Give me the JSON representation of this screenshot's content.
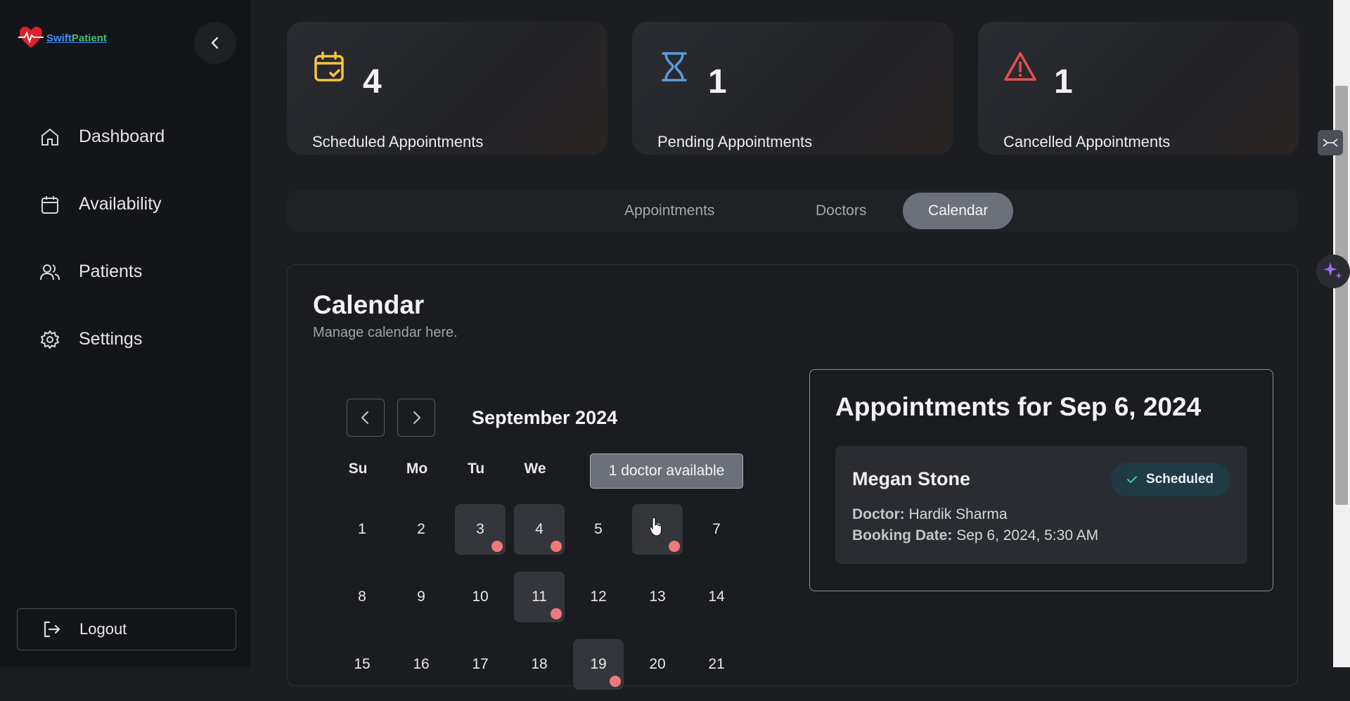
{
  "app": {
    "name_part1": "Swift",
    "name_part2": "Patient"
  },
  "sidebar": {
    "items": [
      {
        "label": "Dashboard",
        "icon": "home-icon"
      },
      {
        "label": "Availability",
        "icon": "calendar-icon"
      },
      {
        "label": "Patients",
        "icon": "users-icon"
      },
      {
        "label": "Settings",
        "icon": "gear-icon"
      }
    ],
    "logout_label": "Logout"
  },
  "stats": [
    {
      "value": "4",
      "label": "Scheduled Appointments",
      "icon": "calendar-check-icon",
      "color": "#f5c542"
    },
    {
      "value": "1",
      "label": "Pending Appointments",
      "icon": "hourglass-icon",
      "color": "#5b9be0"
    },
    {
      "value": "1",
      "label": "Cancelled Appointments",
      "icon": "warning-icon",
      "color": "#e85050"
    }
  ],
  "tabs": [
    {
      "label": "Appointments",
      "active": false
    },
    {
      "label": "Doctors",
      "active": false
    },
    {
      "label": "Calendar",
      "active": true
    }
  ],
  "calendar": {
    "title": "Calendar",
    "subtitle": "Manage calendar here.",
    "month_label": "September 2024",
    "weekdays": [
      "Su",
      "Mo",
      "Tu",
      "We"
    ],
    "tooltip": "1 doctor available",
    "days": [
      {
        "n": "1",
        "has": false
      },
      {
        "n": "2",
        "has": false
      },
      {
        "n": "3",
        "has": true
      },
      {
        "n": "4",
        "has": true
      },
      {
        "n": "5",
        "has": false
      },
      {
        "n": "6",
        "has": true
      },
      {
        "n": "7",
        "has": false
      },
      {
        "n": "8",
        "has": false
      },
      {
        "n": "9",
        "has": false
      },
      {
        "n": "10",
        "has": false
      },
      {
        "n": "11",
        "has": true
      },
      {
        "n": "12",
        "has": false
      },
      {
        "n": "13",
        "has": false
      },
      {
        "n": "14",
        "has": false
      },
      {
        "n": "15",
        "has": false
      },
      {
        "n": "16",
        "has": false
      },
      {
        "n": "17",
        "has": false
      },
      {
        "n": "18",
        "has": false
      },
      {
        "n": "19",
        "has": true
      },
      {
        "n": "20",
        "has": false
      },
      {
        "n": "21",
        "has": false
      }
    ]
  },
  "appointments": {
    "title": "Appointments for Sep 6, 2024",
    "items": [
      {
        "name": "Megan Stone",
        "status": "Scheduled",
        "doctor_label": "Doctor:",
        "doctor": "Hardik Sharma",
        "booking_label": "Booking Date:",
        "booking": "Sep 6, 2024, 5:30 AM"
      }
    ]
  }
}
